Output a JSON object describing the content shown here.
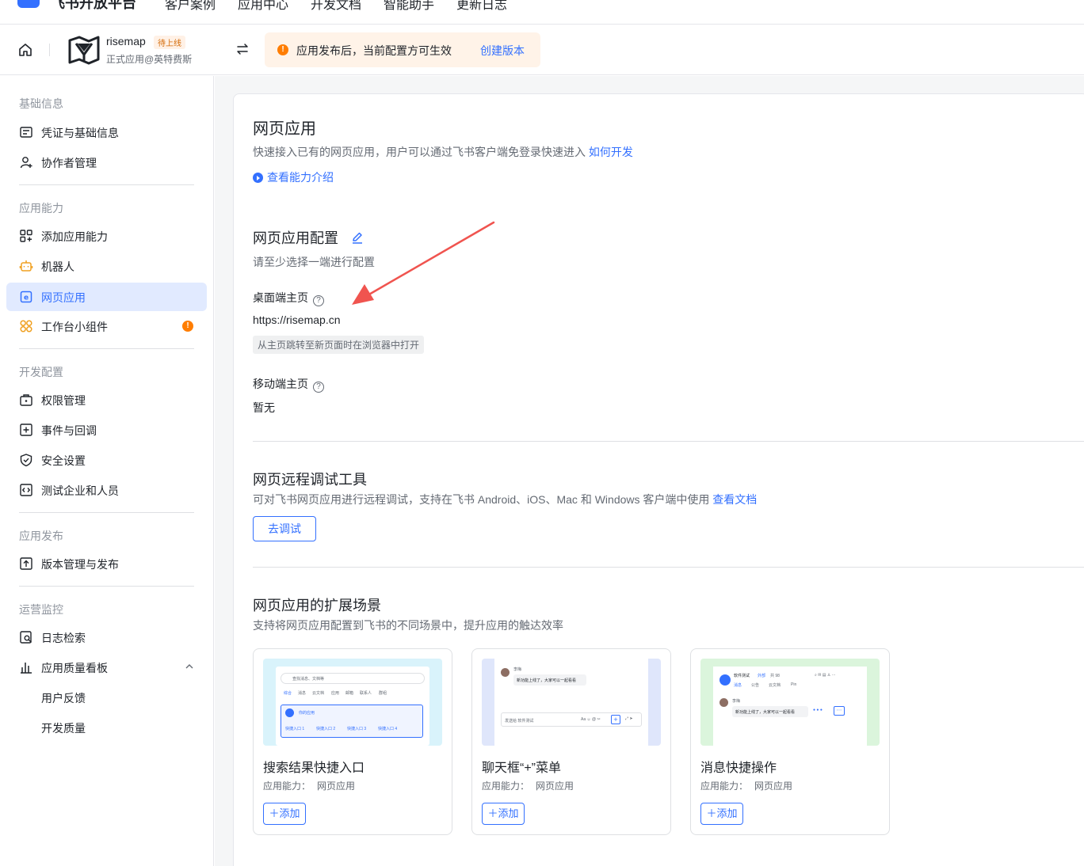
{
  "topnav": {
    "brand": "飞书开放平台",
    "items": [
      "客户案例",
      "应用中心",
      "开发文档",
      "智能助手",
      "更新日志"
    ]
  },
  "app": {
    "name": "risemap",
    "badge": "待上线",
    "subtitle": "正式应用@英特费斯"
  },
  "notice": {
    "text": "应用发布后，当前配置方可生效",
    "link": "创建版本"
  },
  "sidebar": {
    "groups": {
      "basic": "基础信息",
      "ability": "应用能力",
      "dev": "开发配置",
      "release": "应用发布",
      "ops": "运营监控"
    },
    "items": {
      "credentials": "凭证与基础信息",
      "collaborators": "协作者管理",
      "add_ability": "添加应用能力",
      "bot": "机器人",
      "web_app": "网页应用",
      "widget": "工作台小组件",
      "widget_badge": "!",
      "permissions": "权限管理",
      "events": "事件与回调",
      "security": "安全设置",
      "test_org": "测试企业和人员",
      "versions": "版本管理与发布",
      "logs": "日志检索",
      "quality_board": "应用质量看板",
      "feedback": "用户反馈",
      "dev_quality": "开发质量"
    }
  },
  "main": {
    "title": "网页应用",
    "desc": "快速接入已有的网页应用，用户可以通过飞书客户端免登录快速进入",
    "desc_link": "如何开发",
    "intro_link": "查看能力介绍",
    "config": {
      "title": "网页应用配置",
      "hint": "请至少选择一端进行配置",
      "desktop_label": "桌面端主页",
      "desktop_url": "https://risemap.cn",
      "desktop_tag": "从主页跳转至新页面时在浏览器中打开",
      "mobile_label": "移动端主页",
      "mobile_value": "暂无"
    },
    "debug": {
      "title": "网页远程调试工具",
      "desc": "可对飞书网页应用进行远程调试，支持在飞书 Android、iOS、Mac 和 Windows 客户端中使用",
      "desc_link": "查看文档",
      "button": "去调试"
    },
    "scenes": {
      "title": "网页应用的扩展场景",
      "desc": "支持将网页应用配置到飞书的不同场景中，提升应用的触达效率",
      "cards": [
        {
          "title": "搜索结果快捷入口",
          "cap_label": "应用能力：",
          "cap_value": "网页应用",
          "add": "添加"
        },
        {
          "title": "聊天框“+”菜单",
          "cap_label": "应用能力：",
          "cap_value": "网页应用",
          "add": "添加"
        },
        {
          "title": "消息快捷操作",
          "cap_label": "应用能力：",
          "cap_value": "网页应用",
          "add": "添加"
        }
      ],
      "thumb1": {
        "search_placeholder": "查找消息、文档等",
        "tabs": [
          "综合",
          "消息",
          "云文档",
          "应用",
          "邮箱",
          "联系人",
          "群组"
        ],
        "app_label": "你的应用",
        "shortcuts": [
          "快捷入口 1",
          "快捷入口 2",
          "快捷入口 3",
          "快捷入口 4"
        ]
      },
      "thumb2": {
        "sender": "李梅",
        "message": "新功能上线了，大家可以一起看看",
        "input_placeholder": "发送给 软件测试"
      },
      "thumb3": {
        "group": "软件测试",
        "group_tag": "外部",
        "count": "共 98",
        "tabs": [
          "消息",
          "公告",
          "云文档",
          "Pin"
        ],
        "sender": "李梅",
        "message": "新功能上线了，大家可以一起看看"
      }
    }
  },
  "colors": {
    "accent": "#3370ff",
    "warning": "#ff7d00",
    "arrow": "#f0544f"
  }
}
